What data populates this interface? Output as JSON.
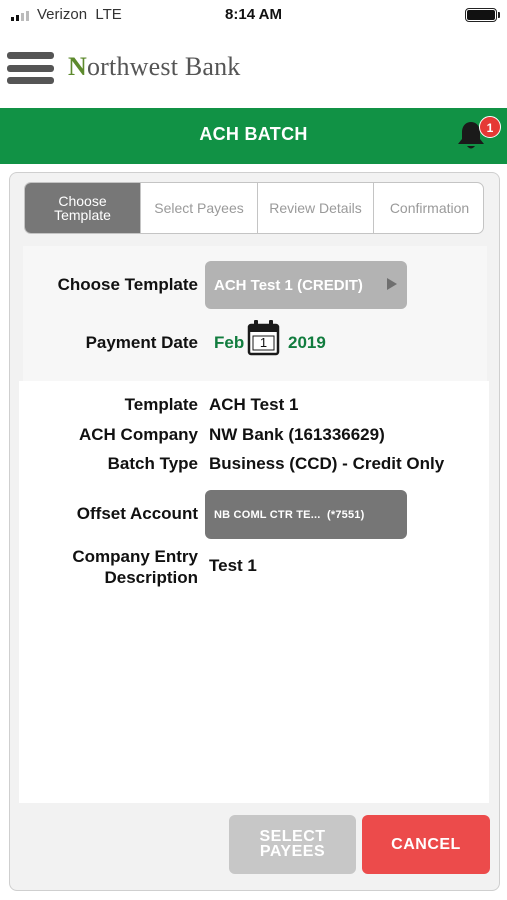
{
  "status_bar": {
    "carrier": "Verizon",
    "network": "LTE",
    "time": "8:14 AM"
  },
  "header": {
    "logo_initial": "N",
    "logo_rest": "orthwest Bank"
  },
  "title_bar": {
    "title": "ACH BATCH",
    "notification_count": "1"
  },
  "stepper": {
    "steps": [
      {
        "line1": "Choose",
        "line2": "Template"
      },
      {
        "label": "Select Payees"
      },
      {
        "label": "Review Details"
      },
      {
        "label": "Confirmation"
      }
    ],
    "active_index": 0
  },
  "template_section": {
    "choose_template_label": "Choose Template",
    "template_value": "ACH Test 1 (CREDIT)",
    "payment_date_label": "Payment Date",
    "date_month": "Feb",
    "date_day": "1",
    "date_year": "2019"
  },
  "details": {
    "template_label": "Template",
    "template_value": "ACH Test 1",
    "ach_company_label": "ACH Company",
    "ach_company_value": "NW Bank (161336629)",
    "batch_type_label": "Batch Type",
    "batch_type_value": "Business (CCD) - Credit Only",
    "offset_account_label": "Offset Account",
    "offset_account_value": "NB COML CTR TE...  (*7551)",
    "company_entry_label_line1": "Company Entry",
    "company_entry_label_line2": "Description",
    "company_entry_value": "Test 1"
  },
  "footer": {
    "select_payees_line1": "SELECT",
    "select_payees_line2": "PAYEES",
    "cancel_label": "CANCEL"
  },
  "colors": {
    "brand_green": "#119245",
    "date_green": "#117c3e",
    "cancel_red": "#ec4b4b",
    "badge_red": "#e53935"
  }
}
